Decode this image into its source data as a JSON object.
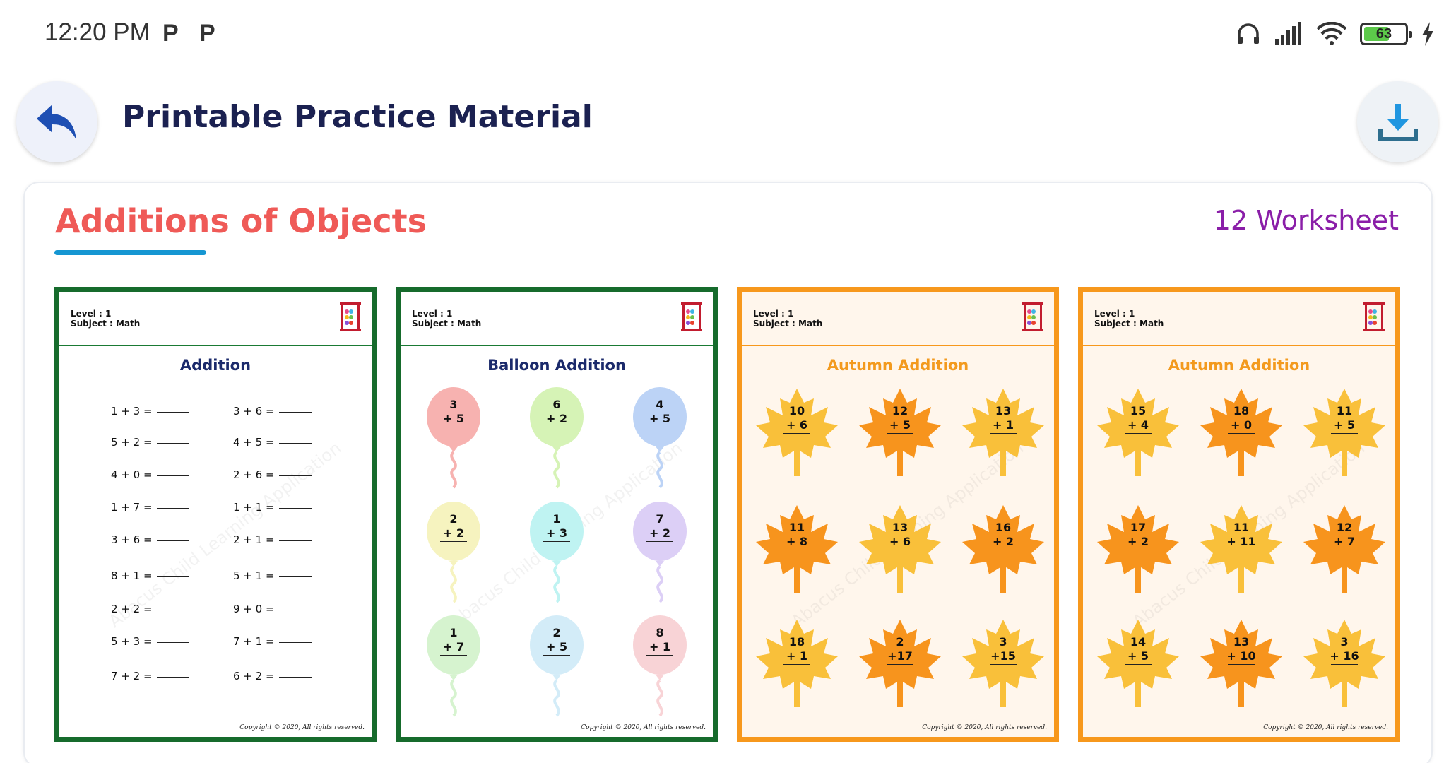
{
  "status_bar": {
    "time": "12:20 PM",
    "notif_1": "P",
    "notif_2": "P",
    "battery": "63",
    "battery_level": 0.63
  },
  "header": {
    "title": "Printable Practice Material",
    "back_icon": "undo-arrow-icon",
    "download_icon": "download-icon"
  },
  "section": {
    "title": "Additions of Objects",
    "count_label": "12 Worksheet",
    "title_color": "#ef5a57",
    "count_color": "#8a1ea8",
    "underline_color": "#1596d2"
  },
  "worksheets": [
    {
      "level": "Level : 1",
      "subject": "Subject : Math",
      "title": "Addition",
      "copyright": "Copyright © 2020, All rights reserved.",
      "watermark": "Abacus Child Learning Application",
      "left_equations": [
        "1 + 3 =",
        "5 + 2 =",
        "4 + 0 =",
        "1 + 7 =",
        "3 + 6 =",
        "8 + 1 =",
        "2 + 2 =",
        "5 + 3 =",
        "7 + 2 ="
      ],
      "right_equations": [
        "3 + 6 =",
        "4 + 5 =",
        "2 + 6 =",
        "1 + 1 =",
        "2 + 1 =",
        "5 + 1 =",
        "9 + 0 =",
        "7 + 1 =",
        "6 + 2 ="
      ]
    },
    {
      "level": "Level : 1",
      "subject": "Subject : Math",
      "title": "Balloon Addition",
      "copyright": "Copyright © 2020, All rights reserved.",
      "watermark": "Abacus Child Learning Application",
      "problems": [
        {
          "top": "3",
          "bottom": "+ 5",
          "color": "#f7b2b0"
        },
        {
          "top": "6",
          "bottom": "+ 2",
          "color": "#d6f3b6"
        },
        {
          "top": "4",
          "bottom": "+ 5",
          "color": "#bcd3f6"
        },
        {
          "top": "2",
          "bottom": "+ 2",
          "color": "#f6f3bf"
        },
        {
          "top": "1",
          "bottom": "+ 3",
          "color": "#bff3f2"
        },
        {
          "top": "7",
          "bottom": "+ 2",
          "color": "#dccff6"
        },
        {
          "top": "1",
          "bottom": "+ 7",
          "color": "#d6f3cf"
        },
        {
          "top": "2",
          "bottom": "+ 5",
          "color": "#d3ecf8"
        },
        {
          "top": "8",
          "bottom": "+ 1",
          "color": "#f8d3d6"
        }
      ]
    },
    {
      "level": "Level : 1",
      "subject": "Subject : Math",
      "title": "Autumn Addition",
      "copyright": "Copyright © 2020, All rights reserved.",
      "watermark": "Abacus Child Learning Application",
      "problems": [
        {
          "top": "10",
          "bottom": "+ 6",
          "color": "#f9c03a"
        },
        {
          "top": "12",
          "bottom": "+ 5",
          "color": "#f7941d"
        },
        {
          "top": "13",
          "bottom": "+ 1",
          "color": "#f9c03a"
        },
        {
          "top": "11",
          "bottom": "+ 8",
          "color": "#f7941d"
        },
        {
          "top": "13",
          "bottom": "+ 6",
          "color": "#f9c03a"
        },
        {
          "top": "16",
          "bottom": "+ 2",
          "color": "#f7941d"
        },
        {
          "top": "18",
          "bottom": "+ 1",
          "color": "#f9c03a"
        },
        {
          "top": "2",
          "bottom": "+17",
          "color": "#f7941d"
        },
        {
          "top": "3",
          "bottom": "+15",
          "color": "#f9c03a"
        }
      ]
    },
    {
      "level": "Level : 1",
      "subject": "Subject : Math",
      "title": "Autumn Addition",
      "copyright": "Copyright © 2020, All rights reserved.",
      "watermark": "Abacus Child Learning Application",
      "problems": [
        {
          "top": "15",
          "bottom": "+ 4",
          "color": "#f9c03a"
        },
        {
          "top": "18",
          "bottom": "+ 0",
          "color": "#f7941d"
        },
        {
          "top": "11",
          "bottom": "+ 5",
          "color": "#f9c03a"
        },
        {
          "top": "17",
          "bottom": "+ 2",
          "color": "#f7941d"
        },
        {
          "top": "11",
          "bottom": "+ 11",
          "color": "#f9c03a"
        },
        {
          "top": "12",
          "bottom": "+ 7",
          "color": "#f7941d"
        },
        {
          "top": "14",
          "bottom": "+ 5",
          "color": "#f9c03a"
        },
        {
          "top": "13",
          "bottom": "+ 10",
          "color": "#f7941d"
        },
        {
          "top": "3",
          "bottom": "+ 16",
          "color": "#f9c03a"
        }
      ]
    }
  ]
}
